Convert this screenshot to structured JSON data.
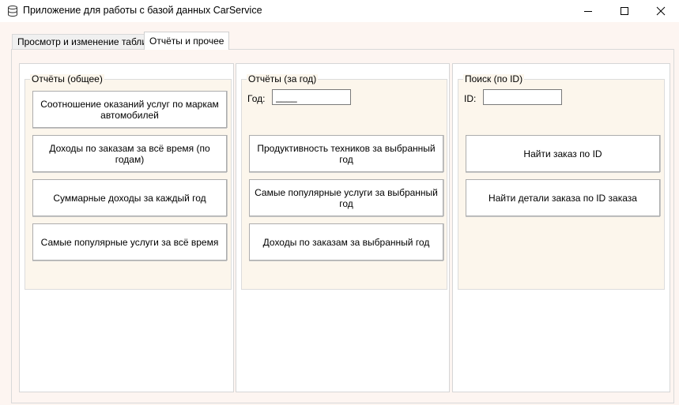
{
  "window": {
    "title": "Приложение для работы с базой данных CarService"
  },
  "tabs": [
    {
      "label": "Просмотр и изменение таблиц",
      "selected": false
    },
    {
      "label": "Отчёты и прочее",
      "selected": true
    }
  ],
  "groups": {
    "general": {
      "title": "Отчёты (общее)",
      "buttons": [
        "Соотношение оказаний услуг по маркам автомобилей",
        "Доходы по заказам за всё время (по годам)",
        "Суммарные доходы за каждый год",
        "Самые популярные услуги за всё время"
      ]
    },
    "year": {
      "title": "Отчёты (за год)",
      "year_label": "Год:",
      "year_value": "____",
      "buttons": [
        "Продуктивность техников за выбранный год",
        "Самые популярные услуги за выбранный год",
        "Доходы по заказам за выбранный год"
      ]
    },
    "search": {
      "title": "Поиск (по ID)",
      "id_label": "ID:",
      "id_value": "",
      "buttons": [
        "Найти заказ по ID",
        "Найти детали заказа по ID заказа"
      ]
    }
  },
  "colors": {
    "window_bg": "#fdf5f1",
    "group_bg": "#fcf6ec",
    "panel_bg": "#ffffff",
    "button_border": "#adadad"
  },
  "icons": {
    "app": "database-icon",
    "minimize": "minimize-icon",
    "maximize": "maximize-icon",
    "close": "close-icon"
  }
}
